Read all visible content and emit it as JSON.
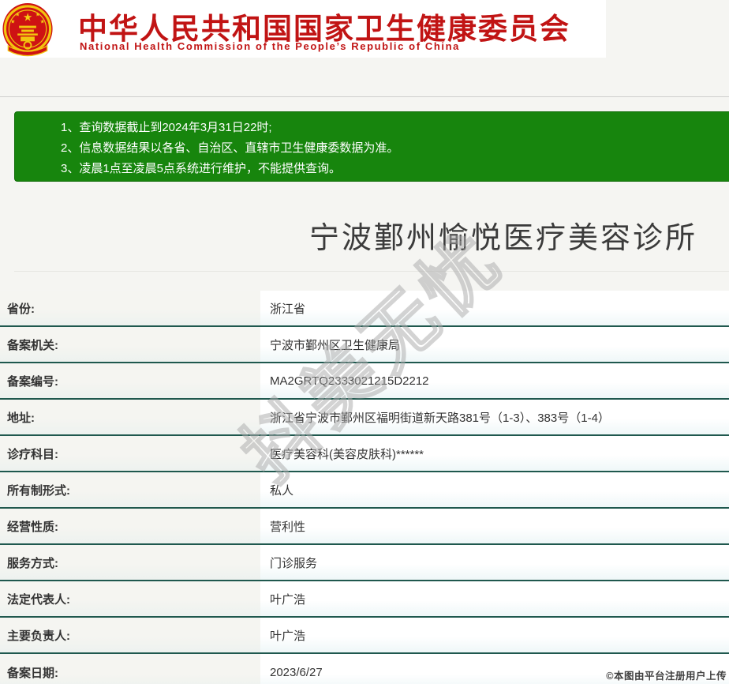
{
  "header": {
    "title_cn": "中华人民共和国国家卫生健康委员会",
    "title_en": "National Health Commission of the People’s Republic of China"
  },
  "notice": {
    "items": [
      "1、查询数据截止到2024年3月31日22时;",
      "2、信息数据结果以各省、自治区、直辖市卫生健康委数据为准。",
      "3、凌晨1点至凌晨5点系统进行维护，不能提供查询。"
    ]
  },
  "result": {
    "title": "宁波鄞州愉悦医疗美容诊所",
    "fields": [
      {
        "label": "省份:",
        "value": "浙江省"
      },
      {
        "label": "备案机关:",
        "value": "宁波市鄞州区卫生健康局"
      },
      {
        "label": "备案编号:",
        "value": "MA2GRTQ2333021215D2212"
      },
      {
        "label": "地址:",
        "value": "浙江省宁波市鄞州区福明街道新天路381号（1-3）、383号（1-4）"
      },
      {
        "label": "诊疗科目:",
        "value": "医疗美容科(美容皮肤科)******"
      },
      {
        "label": "所有制形式:",
        "value": "私人"
      },
      {
        "label": "经营性质:",
        "value": "营利性"
      },
      {
        "label": "服务方式:",
        "value": "门诊服务"
      },
      {
        "label": "法定代表人:",
        "value": "叶广浩"
      },
      {
        "label": "主要负责人:",
        "value": "叶广浩"
      },
      {
        "label": "备案日期:",
        "value": "2023/6/27"
      }
    ]
  },
  "watermark_text": "抖美无忧",
  "footer_note": "©本图由平台注册用户上传",
  "colors": {
    "header_red": "#c11414",
    "notice_green": "#17850d",
    "table_divider_teal": "#1f584e",
    "page_gray": "#f5f5f2"
  }
}
